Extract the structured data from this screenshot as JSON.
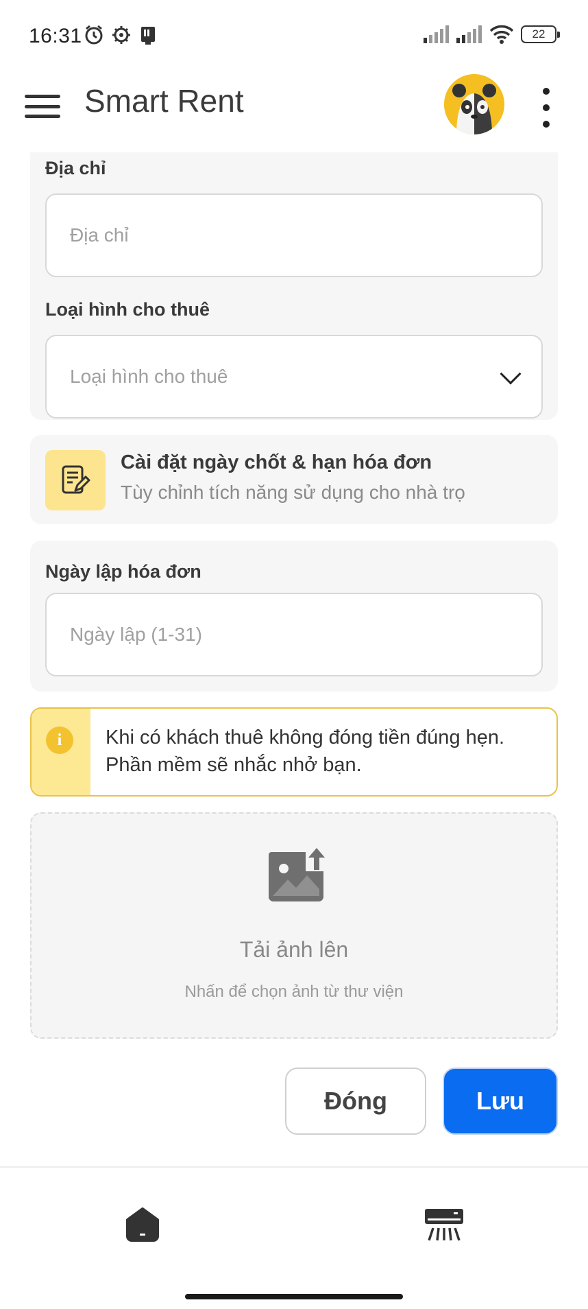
{
  "status_bar": {
    "time": "16:31",
    "battery": "22",
    "icons": [
      "alarm-icon",
      "gear-icon",
      "sim-icon",
      "signal-icon",
      "signal-icon",
      "wifi-icon",
      "battery-icon"
    ]
  },
  "app_bar": {
    "title": "Smart Rent",
    "icons": [
      "menu-icon",
      "panda-avatar",
      "more-vertical-icon"
    ]
  },
  "address_section": {
    "address_label": "Địa chỉ",
    "address_placeholder": "Địa chỉ",
    "rental_type_label": "Loại hình cho thuê",
    "rental_type_placeholder": "Loại hình cho thuê"
  },
  "invoice_settings": {
    "title": "Cài đặt ngày chốt & hạn hóa đơn",
    "subtitle": "Tùy chỉnh tích năng sử dụng cho nhà trọ",
    "icon": "edit-note-icon"
  },
  "invoice_date": {
    "label": "Ngày lập hóa đơn",
    "placeholder": "Ngày lập (1-31)"
  },
  "notice": {
    "icon_glyph": "i",
    "text": "Khi có khách thuê không đóng tiền đúng hẹn. Phần mềm sẽ nhắc nhở bạn."
  },
  "upload": {
    "title": "Tải ảnh lên",
    "subtitle": "Nhấn để chọn ảnh từ thư viện"
  },
  "actions": {
    "close_label": "Đóng",
    "save_label": "Lưu"
  },
  "bottom_nav": {
    "items": [
      "home-icon",
      "air-conditioner-icon"
    ]
  },
  "colors": {
    "primary": "#0a6cf0",
    "notice_accent": "#fde894",
    "card_bg": "#f6f6f6"
  }
}
